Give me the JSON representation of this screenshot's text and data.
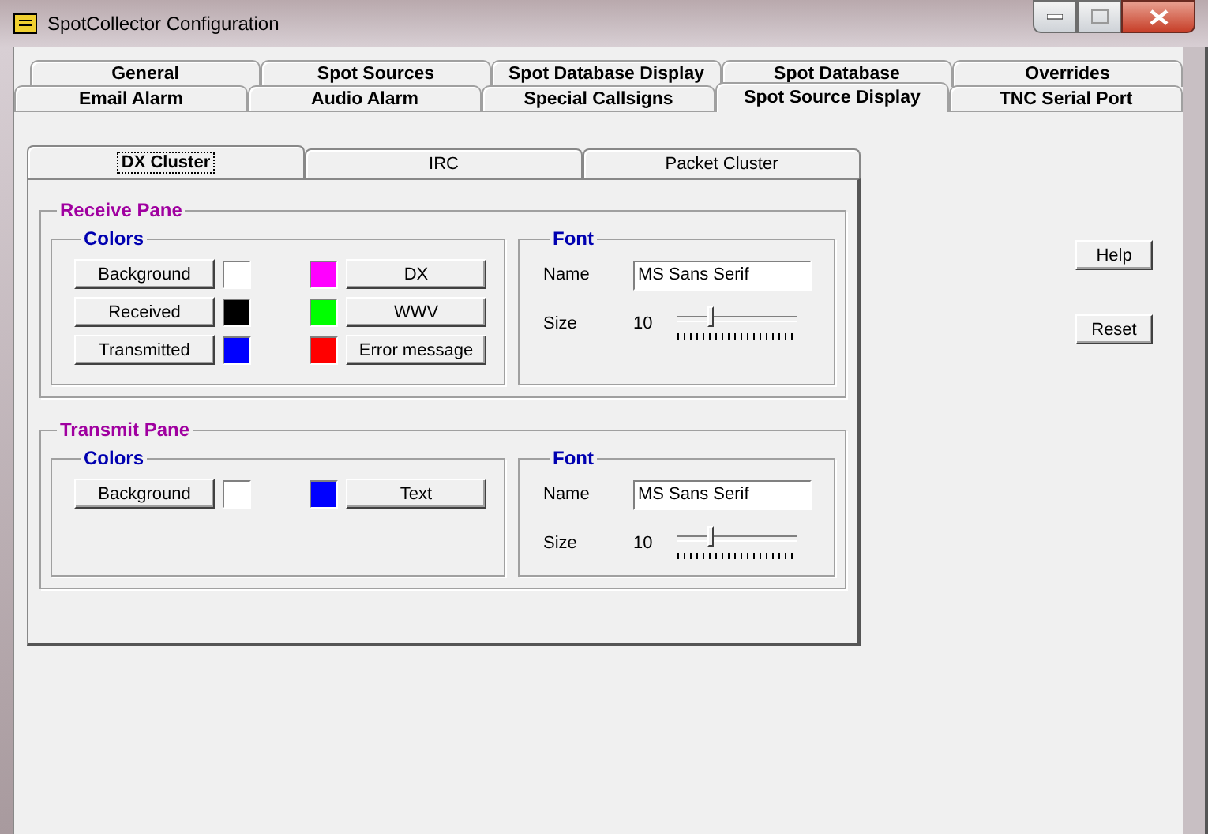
{
  "window": {
    "title": "SpotCollector Configuration"
  },
  "tab_rows": [
    [
      {
        "label": "General",
        "selected": false
      },
      {
        "label": "Spot Sources",
        "selected": false
      },
      {
        "label": "Spot Database Display",
        "selected": false
      },
      {
        "label": "Spot Database",
        "selected": false
      },
      {
        "label": "Overrides",
        "selected": false
      }
    ],
    [
      {
        "label": "Email Alarm",
        "selected": false
      },
      {
        "label": "Audio Alarm",
        "selected": false
      },
      {
        "label": "Special Callsigns",
        "selected": false
      },
      {
        "label": "Spot Source Display",
        "selected": true
      },
      {
        "label": "TNC Serial Port",
        "selected": false
      }
    ]
  ],
  "source_tabs": [
    {
      "label": "DX Cluster",
      "selected": true
    },
    {
      "label": "IRC",
      "selected": false
    },
    {
      "label": "Packet Cluster",
      "selected": false
    }
  ],
  "panes": [
    {
      "title": "Receive Pane",
      "colors": {
        "title": "Colors",
        "rows": [
          {
            "left": {
              "label": "Background",
              "color": "#ffffff"
            },
            "right": {
              "label": "DX",
              "color": "#ff00ff"
            }
          },
          {
            "left": {
              "label": "Received",
              "color": "#000000"
            },
            "right": {
              "label": "WWV",
              "color": "#00ff00"
            }
          },
          {
            "left": {
              "label": "Transmitted",
              "color": "#0000ff"
            },
            "right": {
              "label": "Error message",
              "color": "#ff0000"
            }
          }
        ]
      },
      "font": {
        "title": "Font",
        "name_label": "Name",
        "name_value": "MS Sans Serif",
        "size_label": "Size",
        "size_value": "10",
        "level": 0.28
      }
    },
    {
      "title": "Transmit Pane",
      "colors": {
        "title": "Colors",
        "rows": [
          {
            "left": {
              "label": "Background",
              "color": "#ffffff"
            },
            "right": {
              "label": "Text",
              "color": "#0000ff"
            }
          }
        ]
      },
      "font": {
        "title": "Font",
        "name_label": "Name",
        "name_value": "MS Sans Serif",
        "size_label": "Size",
        "size_value": "10",
        "level": 0.28
      }
    }
  ],
  "buttons": [
    "Help",
    "Reset"
  ]
}
